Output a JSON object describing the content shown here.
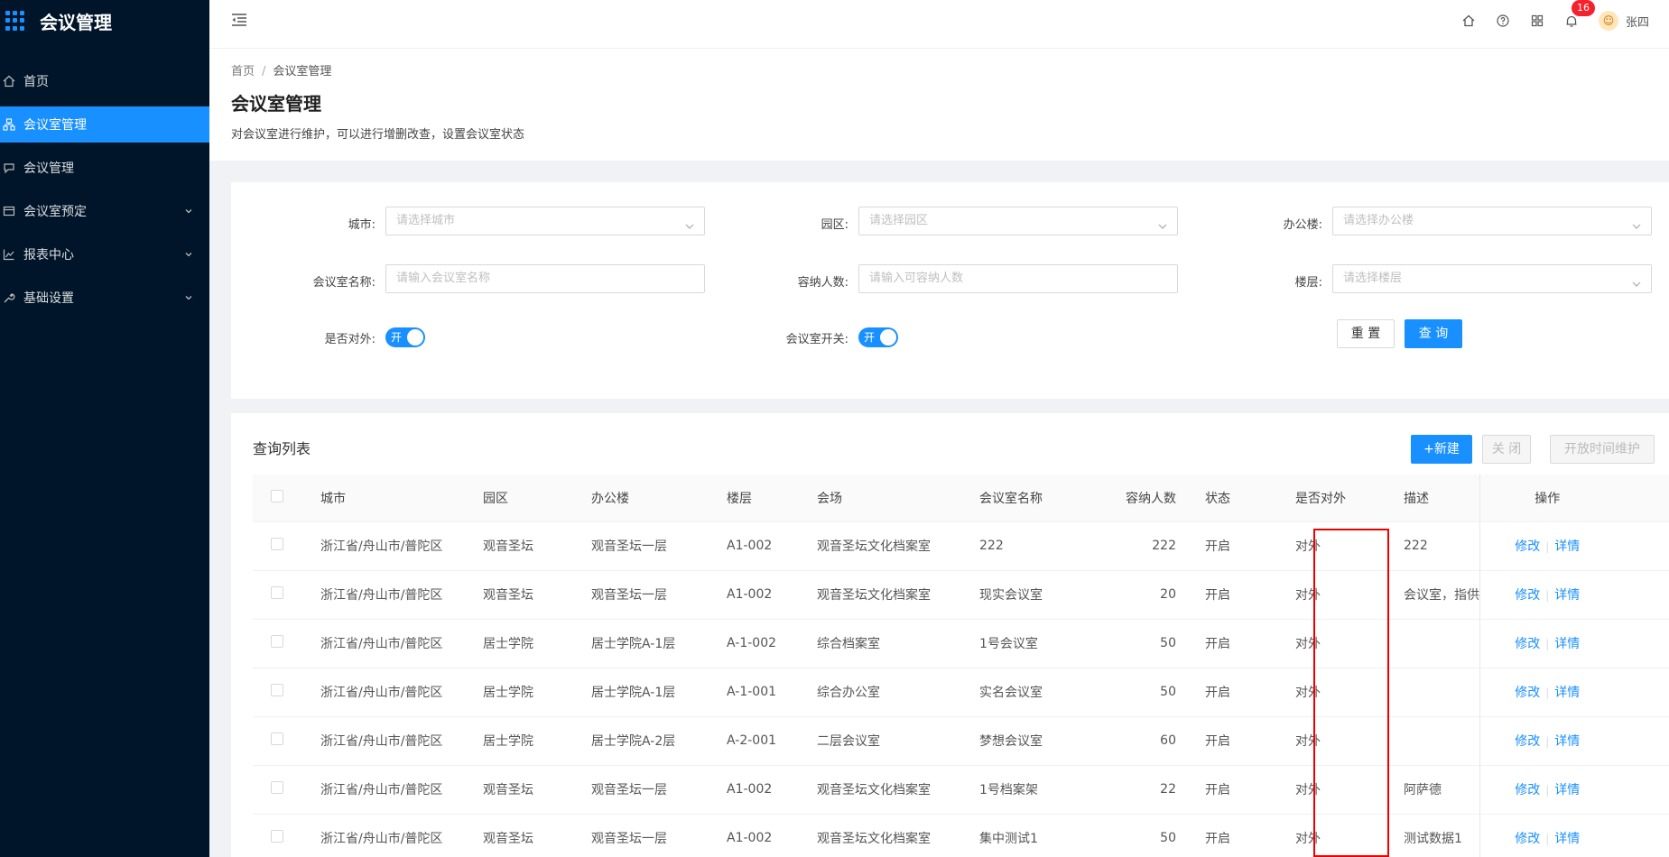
{
  "app": {
    "title": "会议管理"
  },
  "sidebar": {
    "items": [
      {
        "label": "首页",
        "icon": "home-icon",
        "active": false,
        "expandable": false
      },
      {
        "label": "会议室管理",
        "icon": "building-icon",
        "active": true,
        "expandable": false
      },
      {
        "label": "会议管理",
        "icon": "chat-icon",
        "active": false,
        "expandable": false
      },
      {
        "label": "会议室预定",
        "icon": "calendar-icon",
        "active": false,
        "expandable": true
      },
      {
        "label": "报表中心",
        "icon": "chart-icon",
        "active": false,
        "expandable": true
      },
      {
        "label": "基础设置",
        "icon": "wrench-icon",
        "active": false,
        "expandable": true
      }
    ]
  },
  "header": {
    "notification_count": "16",
    "username": "张四"
  },
  "breadcrumb": {
    "home": "首页",
    "separator": "/",
    "current": "会议室管理"
  },
  "page": {
    "title": "会议室管理",
    "description": "对会议室进行维护，可以进行增删改查，设置会议室状态"
  },
  "filters": {
    "city": {
      "label": "城市:",
      "placeholder": "请选择城市"
    },
    "park": {
      "label": "园区:",
      "placeholder": "请选择园区"
    },
    "building": {
      "label": "办公楼:",
      "placeholder": "请选择办公楼"
    },
    "room_name": {
      "label": "会议室名称:",
      "placeholder": "请输入会议室名称"
    },
    "capacity": {
      "label": "容纳人数:",
      "placeholder": "请输入可容纳人数"
    },
    "floor": {
      "label": "楼层:",
      "placeholder": "请选择楼层"
    },
    "external": {
      "label": "是否对外:",
      "switch_text": "开"
    },
    "room_switch": {
      "label": "会议室开关:",
      "switch_text": "开"
    },
    "reset_label": "重 置",
    "query_label": "查 询"
  },
  "list": {
    "title": "查询列表",
    "new_label": "+新建",
    "close_label": "关 闭",
    "maintain_label": "开放时间维护",
    "columns": [
      "城市",
      "园区",
      "办公楼",
      "楼层",
      "会场",
      "会议室名称",
      "容纳人数",
      "状态",
      "是否对外",
      "描述",
      "操作"
    ],
    "edit_label": "修改",
    "detail_label": "详情",
    "op_separator": "|",
    "rows": [
      {
        "city": "浙江省/舟山市/普陀区",
        "park": "观音圣坛",
        "building": "观音圣坛一层",
        "floor": "A1-002",
        "venue": "观音圣坛文化档案室",
        "name": "222",
        "capacity": "222",
        "status": "开启",
        "external": "对外",
        "desc": "222"
      },
      {
        "city": "浙江省/舟山市/普陀区",
        "park": "观音圣坛",
        "building": "观音圣坛一层",
        "floor": "A1-002",
        "venue": "观音圣坛文化档案室",
        "name": "现实会议室",
        "capacity": "20",
        "status": "开启",
        "external": "对外",
        "desc": "会议室，指供"
      },
      {
        "city": "浙江省/舟山市/普陀区",
        "park": "居士学院",
        "building": "居士学院A-1层",
        "floor": "A-1-002",
        "venue": "综合档案室",
        "name": "1号会议室",
        "capacity": "50",
        "status": "开启",
        "external": "对外",
        "desc": ""
      },
      {
        "city": "浙江省/舟山市/普陀区",
        "park": "居士学院",
        "building": "居士学院A-1层",
        "floor": "A-1-001",
        "venue": "综合办公室",
        "name": "实名会议室",
        "capacity": "50",
        "status": "开启",
        "external": "对外",
        "desc": ""
      },
      {
        "city": "浙江省/舟山市/普陀区",
        "park": "居士学院",
        "building": "居士学院A-2层",
        "floor": "A-2-001",
        "venue": "二层会议室",
        "name": "梦想会议室",
        "capacity": "60",
        "status": "开启",
        "external": "对外",
        "desc": ""
      },
      {
        "city": "浙江省/舟山市/普陀区",
        "park": "观音圣坛",
        "building": "观音圣坛一层",
        "floor": "A1-002",
        "venue": "观音圣坛文化档案室",
        "name": "1号档案架",
        "capacity": "22",
        "status": "开启",
        "external": "对外",
        "desc": "阿萨德"
      },
      {
        "city": "浙江省/舟山市/普陀区",
        "park": "观音圣坛",
        "building": "观音圣坛一层",
        "floor": "A1-002",
        "venue": "观音圣坛文化档案室",
        "name": "集中测试1",
        "capacity": "50",
        "status": "开启",
        "external": "对外",
        "desc": "测试数据1"
      }
    ]
  },
  "colors": {
    "sidebar_bg": "#001529",
    "primary": "#1890ff",
    "highlight_box": "#e00000",
    "badge": "#f5222d"
  }
}
